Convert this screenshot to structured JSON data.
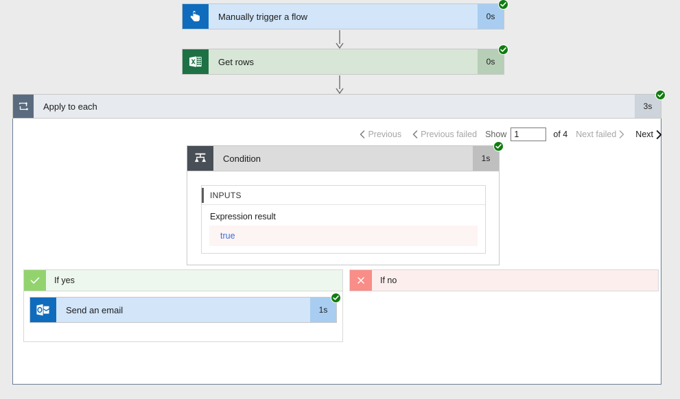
{
  "flow": {
    "trigger": {
      "title": "Manually trigger a flow",
      "duration": "0s",
      "icon": "tap-hand-icon",
      "status": "succeeded"
    },
    "get_rows": {
      "title": "Get rows",
      "duration": "0s",
      "icon": "excel-icon",
      "status": "succeeded"
    },
    "apply_to_each": {
      "title": "Apply to each",
      "duration": "3s",
      "icon": "loop-icon",
      "status": "succeeded"
    },
    "condition": {
      "title": "Condition",
      "duration": "1s",
      "icon": "condition-branch-icon",
      "status": "succeeded",
      "inputs_header": "INPUTS",
      "expression_label": "Expression result",
      "expression_value": "true"
    },
    "if_yes": {
      "label": "If yes",
      "icon": "checkmark-icon"
    },
    "if_no": {
      "label": "If no",
      "icon": "cross-icon"
    },
    "send_email": {
      "title": "Send an email",
      "duration": "1s",
      "icon": "outlook-icon",
      "status": "succeeded"
    }
  },
  "pagination": {
    "previous": "Previous",
    "previous_failed": "Previous failed",
    "show_label": "Show",
    "show_value": "1",
    "of_label": "of 4",
    "next_failed": "Next failed",
    "next": "Next"
  },
  "colors": {
    "canvas": "#ebebeb",
    "success_green": "#107c10",
    "trigger_blue": "#0f6cbd",
    "excel_green": "#1e7145",
    "scope_border": "#6b7c93",
    "yes_green": "#92d36e",
    "no_red": "#f98d87",
    "expression_blue": "#3a6fd8"
  }
}
